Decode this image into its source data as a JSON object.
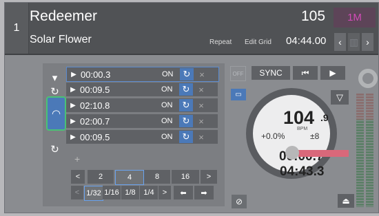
{
  "deck": {
    "number": "1"
  },
  "track": {
    "title": "Redeemer",
    "artist": "Solar Flower",
    "bpm": "105",
    "key": "1M"
  },
  "header_actions": {
    "repeat": "Repeat",
    "edit_grid": "Edit Grid",
    "remaining": "04:44.00"
  },
  "nav": {
    "prev_icon": "chevron-left-icon",
    "next_icon": "chevron-right-icon"
  },
  "cue_rows": [
    {
      "time": "00:00.3",
      "on": "ON"
    },
    {
      "time": "00:09.5",
      "on": "ON"
    },
    {
      "time": "02:10.8",
      "on": "ON"
    },
    {
      "time": "02:00.7",
      "on": "ON"
    },
    {
      "time": "00:09.5",
      "on": "ON"
    }
  ],
  "add_label": "+",
  "beatjump": {
    "prev": "<",
    "values": [
      "2",
      "4",
      "8",
      "16"
    ],
    "selected": "4",
    "next": ">"
  },
  "loopsizes": {
    "prev": "<",
    "values": [
      "1/32",
      "1/16",
      "1/8",
      "1/4"
    ],
    "selected": "1/32",
    "next": ">"
  },
  "transport": {
    "off": "OFF",
    "sync": "SYNC"
  },
  "platter": {
    "bpm_int": "104",
    "bpm_dec": ".9",
    "bpm_label": "BPM",
    "pitch": "+0.0%",
    "range": "±8",
    "elapsed": "00:00.7",
    "remaining": "04:43.3"
  },
  "colors": {
    "accent": "#4b79b8",
    "active_outline": "#49c275",
    "key_color": "#d24bb8",
    "pitch_bar": "#d9687a"
  }
}
